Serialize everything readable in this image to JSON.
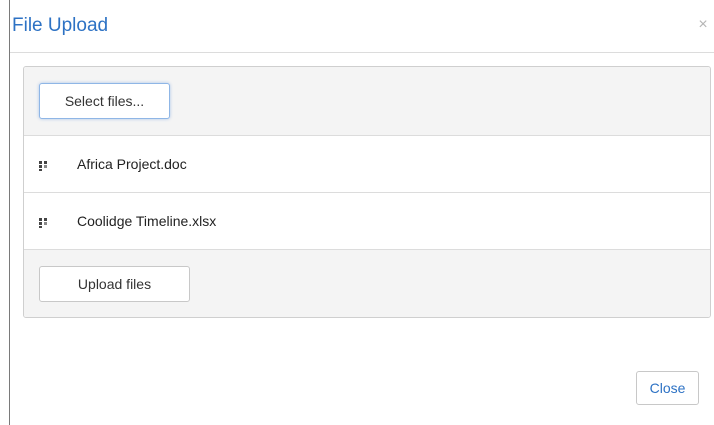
{
  "dialog": {
    "title": "File Upload",
    "close_icon": "×"
  },
  "upload": {
    "select_label": "Select files...",
    "upload_label": "Upload files",
    "files": [
      {
        "name": "Africa Project.doc",
        "icon": "file-status-icon"
      },
      {
        "name": "Coolidge Timeline.xlsx",
        "icon": "file-status-icon"
      }
    ]
  },
  "footer": {
    "close_label": "Close"
  }
}
